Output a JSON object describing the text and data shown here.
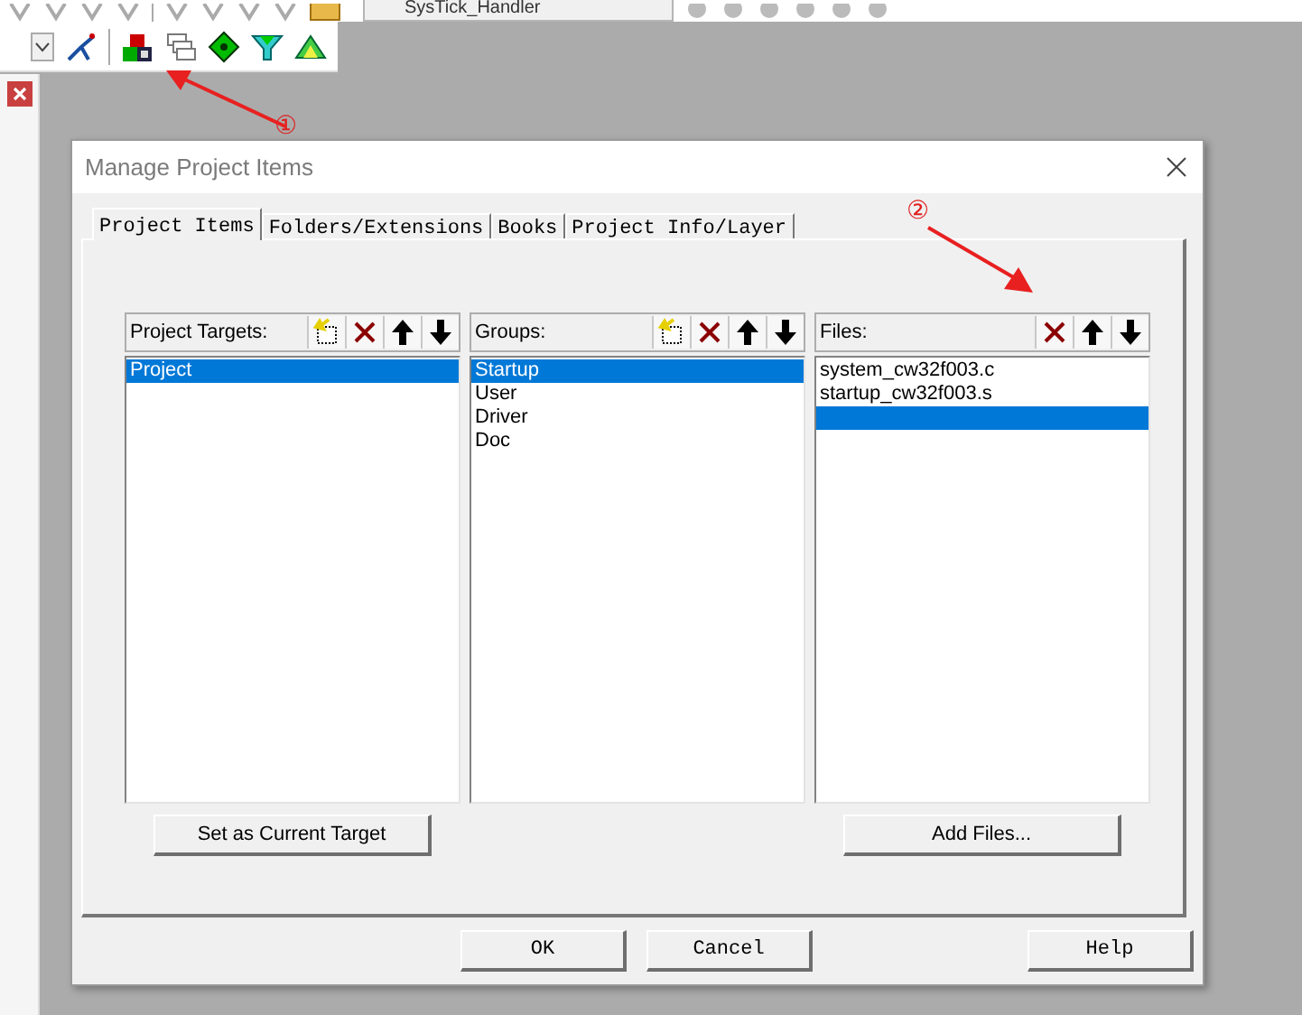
{
  "toolbar": {
    "combo_value": "SysTick_Handler"
  },
  "dialog": {
    "title": "Manage Project Items",
    "tabs": [
      {
        "label": "Project Items",
        "selected": true
      },
      {
        "label": "Folders/Extensions",
        "selected": false
      },
      {
        "label": "Books",
        "selected": false
      },
      {
        "label": "Project Info/Layer",
        "selected": false
      }
    ],
    "panels": [
      {
        "label": "Project Targets:",
        "tools": [
          {
            "kind": "new"
          },
          {
            "kind": "delete"
          },
          {
            "kind": "up"
          },
          {
            "kind": "down"
          }
        ],
        "items": [
          {
            "text": "Project",
            "selected": true
          }
        ],
        "button": "Set as Current Target"
      },
      {
        "label": "Groups:",
        "tools": [
          {
            "kind": "new"
          },
          {
            "kind": "delete"
          },
          {
            "kind": "up"
          },
          {
            "kind": "down"
          }
        ],
        "items": [
          {
            "text": "Startup",
            "selected": true
          },
          {
            "text": "User",
            "selected": false
          },
          {
            "text": "Driver",
            "selected": false
          },
          {
            "text": "Doc",
            "selected": false
          }
        ]
      },
      {
        "label": "Files:",
        "tools": [
          {
            "kind": "delete"
          },
          {
            "kind": "up"
          },
          {
            "kind": "down"
          }
        ],
        "items": [
          {
            "text": "system_cw32f003.c",
            "selected": false
          },
          {
            "text": "startup_cw32f003.s",
            "selected": false
          },
          {
            "selected": true
          }
        ],
        "button": "Add Files..."
      }
    ],
    "buttons": [
      {
        "label": "OK",
        "kind": "ok"
      },
      {
        "label": "Cancel",
        "kind": "cancel"
      },
      {
        "label": "Help",
        "kind": "help"
      }
    ]
  },
  "annotations": [
    {
      "label": "①"
    },
    {
      "label": "②"
    }
  ]
}
